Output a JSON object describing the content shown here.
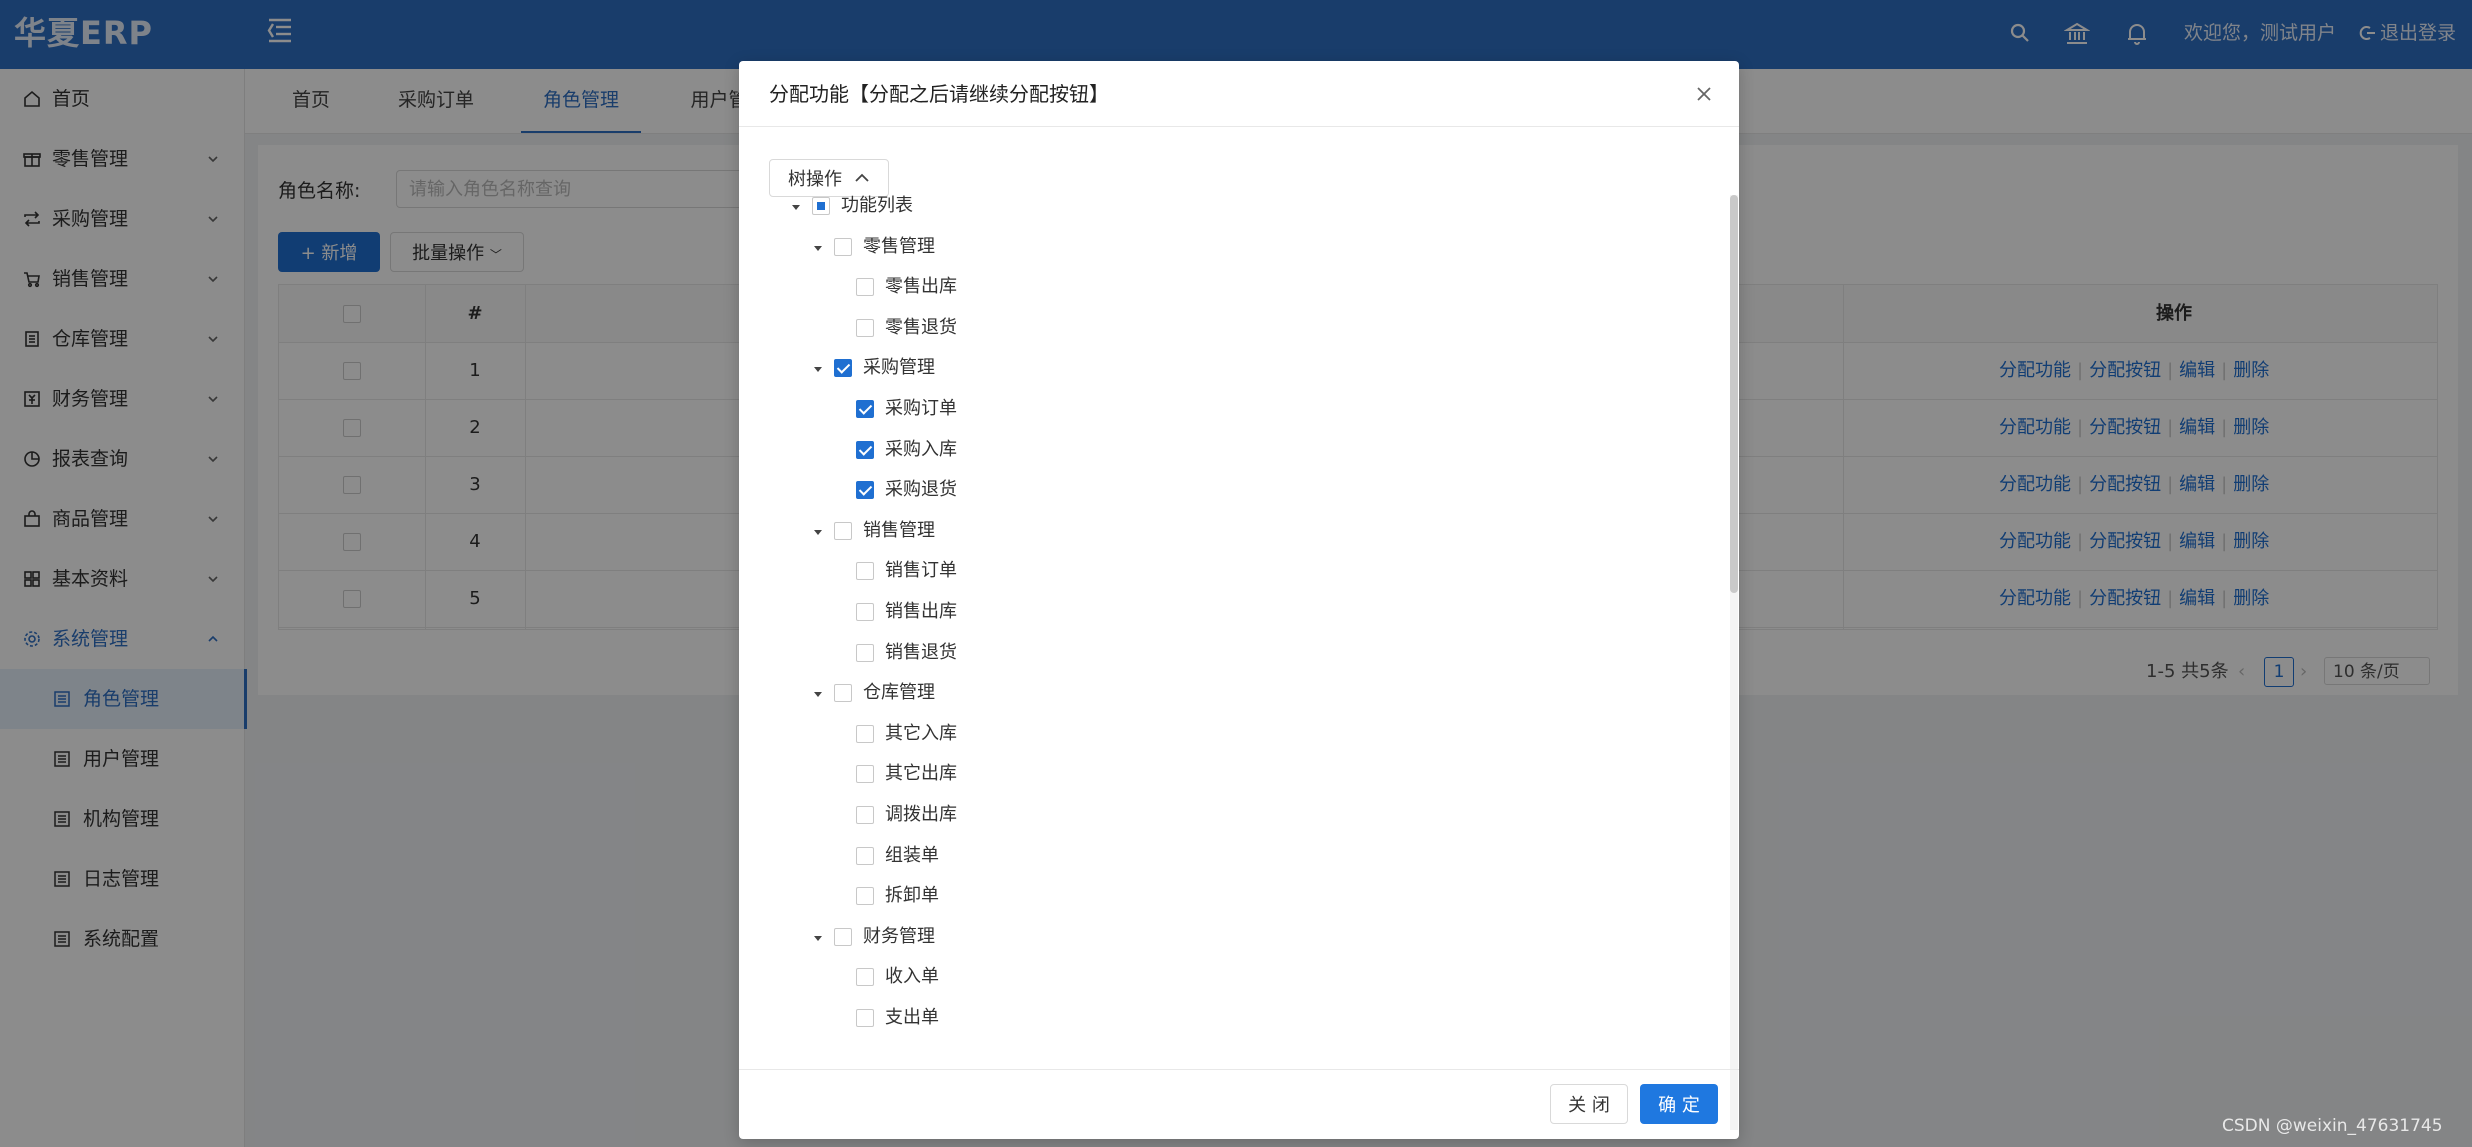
{
  "header": {
    "logo": "华夏ERP",
    "welcome": "欢迎您，测试用户",
    "logout": "退出登录",
    "icons": [
      "search-icon",
      "bank-icon",
      "bell-icon"
    ]
  },
  "sidebar": {
    "items": [
      {
        "label": "首页",
        "icon": "home-icon"
      },
      {
        "label": "零售管理",
        "icon": "gift-icon"
      },
      {
        "label": "采购管理",
        "icon": "swap-icon"
      },
      {
        "label": "销售管理",
        "icon": "cart-icon"
      },
      {
        "label": "仓库管理",
        "icon": "warehouse-icon"
      },
      {
        "label": "财务管理",
        "icon": "finance-icon"
      },
      {
        "label": "报表查询",
        "icon": "pie-chart-icon"
      },
      {
        "label": "商品管理",
        "icon": "shopping-bag-icon"
      },
      {
        "label": "基本资料",
        "icon": "appstore-icon"
      },
      {
        "label": "系统管理",
        "icon": "setting-icon"
      }
    ],
    "subitems": [
      {
        "label": "角色管理"
      },
      {
        "label": "用户管理"
      },
      {
        "label": "机构管理"
      },
      {
        "label": "日志管理"
      },
      {
        "label": "系统配置"
      }
    ]
  },
  "tabs": [
    "首页",
    "采购订单",
    "角色管理",
    "用户管"
  ],
  "search": {
    "label": "角色名称:",
    "placeholder": "请输入角色名称查询"
  },
  "toolbar": {
    "add_label": "新增",
    "batch_label": "批量操作"
  },
  "table": {
    "headers": {
      "index": "#",
      "ops": "操作"
    },
    "rows": [
      {
        "index": "1"
      },
      {
        "index": "2"
      },
      {
        "index": "3"
      },
      {
        "index": "4"
      },
      {
        "index": "5"
      }
    ],
    "ops": {
      "assign_func": "分配功能",
      "assign_btn": "分配按钮",
      "edit": "编辑",
      "delete": "删除"
    }
  },
  "pagination": {
    "summary": "1-5 共5条",
    "current": "1",
    "page_size": "10 条/页"
  },
  "modal": {
    "title": "分配功能【分配之后请继续分配按钮】",
    "tree_button": "树操作",
    "close_label": "关 闭",
    "ok_label": "确 定",
    "tree": [
      {
        "label": "功能列表",
        "level": 0,
        "state": "indeterminate",
        "expandable": true
      },
      {
        "label": "零售管理",
        "level": 1,
        "state": "unchecked",
        "expandable": true
      },
      {
        "label": "零售出库",
        "level": 2,
        "state": "unchecked",
        "expandable": false
      },
      {
        "label": "零售退货",
        "level": 2,
        "state": "unchecked",
        "expandable": false
      },
      {
        "label": "采购管理",
        "level": 1,
        "state": "checked",
        "expandable": true
      },
      {
        "label": "采购订单",
        "level": 2,
        "state": "checked",
        "expandable": false
      },
      {
        "label": "采购入库",
        "level": 2,
        "state": "checked",
        "expandable": false
      },
      {
        "label": "采购退货",
        "level": 2,
        "state": "checked",
        "expandable": false
      },
      {
        "label": "销售管理",
        "level": 1,
        "state": "unchecked",
        "expandable": true
      },
      {
        "label": "销售订单",
        "level": 2,
        "state": "unchecked",
        "expandable": false
      },
      {
        "label": "销售出库",
        "level": 2,
        "state": "unchecked",
        "expandable": false
      },
      {
        "label": "销售退货",
        "level": 2,
        "state": "unchecked",
        "expandable": false
      },
      {
        "label": "仓库管理",
        "level": 1,
        "state": "unchecked",
        "expandable": true
      },
      {
        "label": "其它入库",
        "level": 2,
        "state": "unchecked",
        "expandable": false
      },
      {
        "label": "其它出库",
        "level": 2,
        "state": "unchecked",
        "expandable": false
      },
      {
        "label": "调拨出库",
        "level": 2,
        "state": "unchecked",
        "expandable": false
      },
      {
        "label": "组装单",
        "level": 2,
        "state": "unchecked",
        "expandable": false
      },
      {
        "label": "拆卸单",
        "level": 2,
        "state": "unchecked",
        "expandable": false
      },
      {
        "label": "财务管理",
        "level": 1,
        "state": "unchecked",
        "expandable": true
      },
      {
        "label": "收入单",
        "level": 2,
        "state": "unchecked",
        "expandable": false
      },
      {
        "label": "支出单",
        "level": 2,
        "state": "unchecked",
        "expandable": false
      }
    ]
  },
  "watermark": "CSDN @weixin_47631745",
  "colors": {
    "primary": "#1f6fd1",
    "header": "#2f6fc4"
  }
}
